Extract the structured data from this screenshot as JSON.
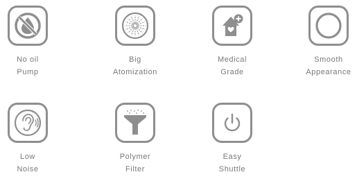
{
  "features": [
    {
      "line1": "No oil",
      "line2": "Pump",
      "icon": "no-oil-drop-icon"
    },
    {
      "line1": "Big",
      "line2": "Atomization",
      "icon": "atomization-burst-icon"
    },
    {
      "line1": "Medical",
      "line2": "Grade",
      "icon": "medical-house-icon"
    },
    {
      "line1": "Smooth",
      "line2": "Appearance",
      "icon": "circle-outline-icon"
    },
    {
      "line1": "Low",
      "line2": "Noise",
      "icon": "ear-sound-icon"
    },
    {
      "line1": "Polymer",
      "line2": "Filter",
      "icon": "funnel-filter-icon"
    },
    {
      "line1": "Easy",
      "line2": "Shuttle",
      "icon": "power-icon"
    }
  ],
  "colors": {
    "icon": "#8e8e8e",
    "text": "#777777"
  }
}
